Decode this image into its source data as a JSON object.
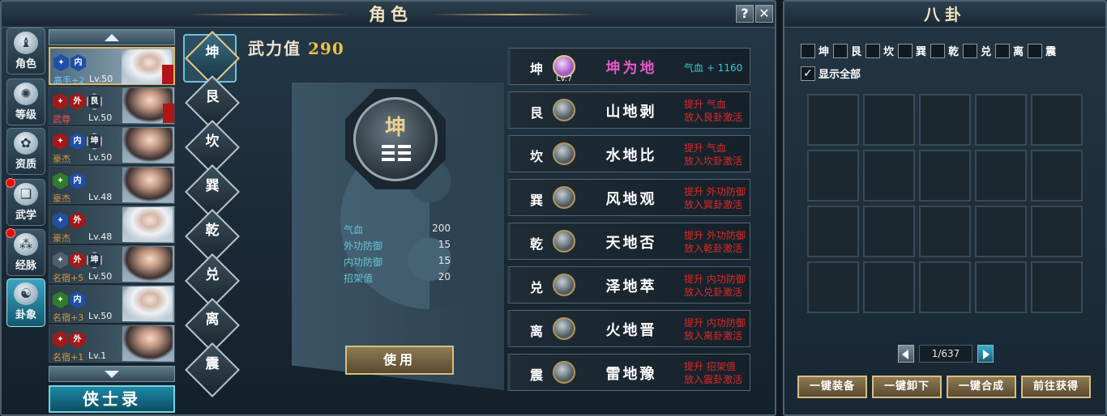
{
  "window": {
    "title": "角色",
    "help": "?",
    "close": "✕"
  },
  "nav": [
    {
      "label": "角色",
      "icon": "character-icon"
    },
    {
      "label": "等级",
      "icon": "level-icon"
    },
    {
      "label": "资质",
      "icon": "aptitude-icon"
    },
    {
      "label": "武学",
      "icon": "martial-arts-icon"
    },
    {
      "label": "经脉",
      "icon": "meridian-icon"
    },
    {
      "label": "卦象",
      "icon": "taiji-icon"
    }
  ],
  "heroes": [
    {
      "badges": [
        "✦",
        "内"
      ],
      "rank": "高手+2",
      "rank_color": "#6ec8ff",
      "level": "Lv.50"
    },
    {
      "badges": [
        "✦",
        "外",
        "艮"
      ],
      "rank": "武尊",
      "rank_color": "#ff4a4a",
      "level": "Lv.50"
    },
    {
      "badges": [
        "✦",
        "内",
        "坤"
      ],
      "rank": "豪杰",
      "rank_color": "#d89a3a",
      "level": "Lv.50"
    },
    {
      "badges": [
        "✦",
        "内"
      ],
      "rank": "豪杰",
      "rank_color": "#d89a3a",
      "level": "Lv.48"
    },
    {
      "badges": [
        "✦",
        "外"
      ],
      "rank": "豪杰",
      "rank_color": "#d89a3a",
      "level": "Lv.48"
    },
    {
      "badges": [
        "✦",
        "外",
        "坤"
      ],
      "rank": "名宿+5",
      "rank_color": "#d89a3a",
      "level": "Lv.50"
    },
    {
      "badges": [
        "✦",
        "内"
      ],
      "rank": "名宿+3",
      "rank_color": "#d89a3a",
      "level": "Lv.50"
    },
    {
      "badges": [
        "✦",
        "外"
      ],
      "rank": "名宿+1",
      "rank_color": "#d89a3a",
      "level": "Lv.1"
    }
  ],
  "roster_button": "侠士录",
  "trigrams": [
    "坤",
    "艮",
    "坎",
    "巽",
    "乾",
    "兑",
    "离",
    "震"
  ],
  "power": {
    "label": "武力值",
    "value": "290"
  },
  "selected": {
    "trigram": "坤"
  },
  "stats": [
    {
      "name": "气血",
      "value": "200"
    },
    {
      "name": "外功防御",
      "value": "15"
    },
    {
      "name": "内功防御",
      "value": "15"
    },
    {
      "name": "招架值",
      "value": "20"
    }
  ],
  "use_button": "使用",
  "hexagrams": [
    {
      "trigram": "坤",
      "name": "坤为地",
      "active": true,
      "orb_level": "Lv.7",
      "bonus": "气血 + 1160"
    },
    {
      "trigram": "艮",
      "name": "山地剥",
      "line1": "提升 气血",
      "line2": "放入艮卦激活"
    },
    {
      "trigram": "坎",
      "name": "水地比",
      "line1": "提升 气血",
      "line2": "放入坎卦激活"
    },
    {
      "trigram": "巽",
      "name": "风地观",
      "line1": "提升 外功防御",
      "line2": "放入巽卦激活"
    },
    {
      "trigram": "乾",
      "name": "天地否",
      "line1": "提升 外功防御",
      "line2": "放入乾卦激活"
    },
    {
      "trigram": "兑",
      "name": "泽地萃",
      "line1": "提升 内功防御",
      "line2": "放入兑卦激活"
    },
    {
      "trigram": "离",
      "name": "火地晋",
      "line1": "提升 内功防御",
      "line2": "放入离卦激活"
    },
    {
      "trigram": "震",
      "name": "雷地豫",
      "line1": "提升 招架值",
      "line2": "放入震卦激活"
    }
  ],
  "side": {
    "title": "八卦",
    "filters": [
      "坤",
      "艮",
      "坎",
      "巽",
      "乾",
      "兑",
      "离",
      "震"
    ],
    "show_all": {
      "checkmark": "✓",
      "label": "显示全部"
    },
    "page": "1/637",
    "buttons": [
      "一键装备",
      "一键卸下",
      "一键合成",
      "前往获得"
    ]
  }
}
